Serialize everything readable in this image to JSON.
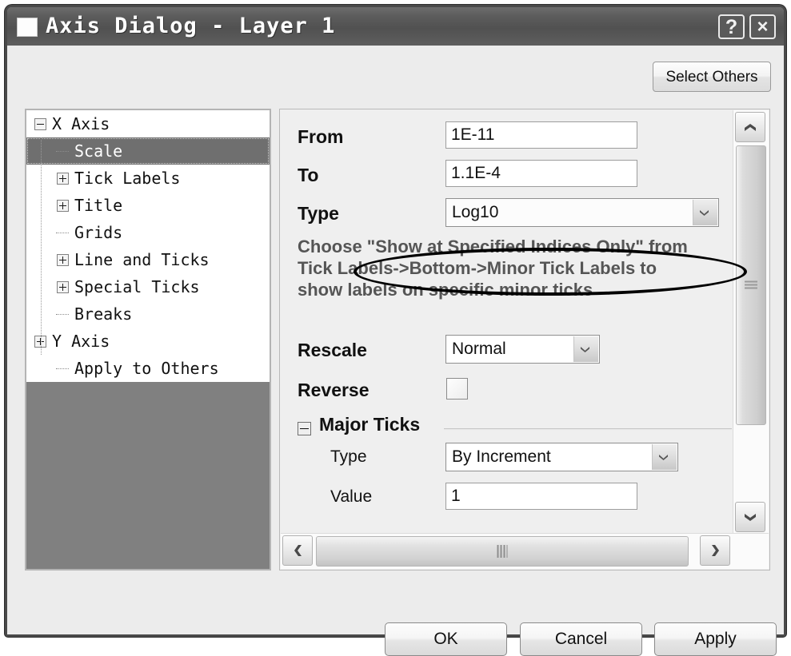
{
  "window": {
    "title": "Axis Dialog - Layer 1",
    "help_label": "?",
    "close_label": "×"
  },
  "toolbar": {
    "select_others_label": "Select Others"
  },
  "tree": {
    "items": [
      {
        "label": "X Axis",
        "indent": 0,
        "expander": "minus",
        "selected": false
      },
      {
        "label": "Scale",
        "indent": 1,
        "expander": "none",
        "selected": true
      },
      {
        "label": "Tick Labels",
        "indent": 1,
        "expander": "plus",
        "selected": false
      },
      {
        "label": "Title",
        "indent": 1,
        "expander": "plus",
        "selected": false
      },
      {
        "label": "Grids",
        "indent": 1,
        "expander": "none",
        "selected": false
      },
      {
        "label": "Line and Ticks",
        "indent": 1,
        "expander": "plus",
        "selected": false
      },
      {
        "label": "Special Ticks",
        "indent": 1,
        "expander": "plus",
        "selected": false
      },
      {
        "label": "Breaks",
        "indent": 1,
        "expander": "none",
        "selected": false
      },
      {
        "label": "Y Axis",
        "indent": 0,
        "expander": "plus",
        "selected": false
      },
      {
        "label": "Apply to Others",
        "indent": 1,
        "expander": "none",
        "selected": false
      }
    ]
  },
  "form": {
    "from_label": "From",
    "from_value": "1E-11",
    "to_label": "To",
    "to_value": "1.1E-4",
    "type_label": "Type",
    "type_value": "Log10",
    "hint": "Choose \"Show at Specified Indices Only\" from\nTick Labels->Bottom->Minor Tick Labels to\nshow labels on specific minor ticks",
    "rescale_label": "Rescale",
    "rescale_value": "Normal",
    "reverse_label": "Reverse",
    "reverse_checked": false,
    "major_ticks": {
      "group_label": "Major Ticks",
      "type_label": "Type",
      "type_value": "By Increment",
      "value_label": "Value",
      "value_value": "1"
    }
  },
  "footer": {
    "ok_label": "OK",
    "cancel_label": "Cancel",
    "apply_label": "Apply"
  },
  "colors": {
    "titlebar": "#5d5d5d",
    "dialog_bg": "#ececec",
    "tree_empty": "#808080",
    "selection": "#6f6f6f",
    "annotation": "#000000"
  }
}
